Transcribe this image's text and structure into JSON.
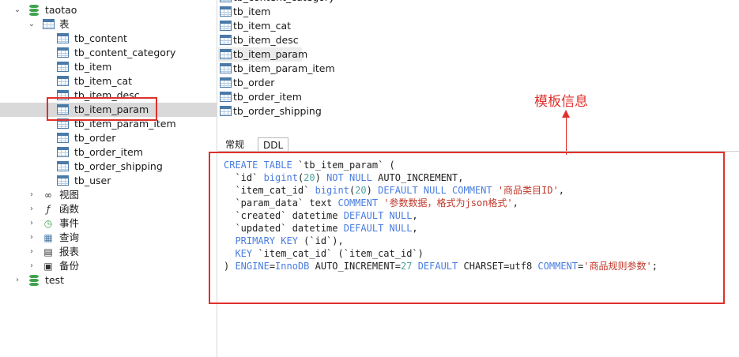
{
  "tree": {
    "db_taotao": "taotao",
    "tables_folder": "表",
    "tables": [
      "tb_content",
      "tb_content_category",
      "tb_item",
      "tb_item_cat",
      "tb_item_desc",
      "tb_item_param",
      "tb_item_param_item",
      "tb_order",
      "tb_order_item",
      "tb_order_shipping",
      "tb_user"
    ],
    "selected_table": "tb_item_param",
    "folders": [
      {
        "label": "视图",
        "icon": "eyeglasses-icon"
      },
      {
        "label": "函数",
        "icon": "function-icon"
      },
      {
        "label": "事件",
        "icon": "event-clock-icon"
      },
      {
        "label": "查询",
        "icon": "query-icon"
      },
      {
        "label": "报表",
        "icon": "report-icon"
      },
      {
        "label": "备份",
        "icon": "backup-icon"
      }
    ],
    "db_test": "test"
  },
  "table_list": {
    "cut_top": "tb_content_category",
    "items": [
      "tb_item",
      "tb_item_cat",
      "tb_item_desc",
      "tb_item_param",
      "tb_item_param_item",
      "tb_order",
      "tb_order_item",
      "tb_order_shipping"
    ],
    "hovered": "tb_item_param"
  },
  "annotation": "模板信息",
  "tabs": [
    "常规",
    "DDL"
  ],
  "active_tab": "DDL",
  "ddl": {
    "l1_kw": "CREATE TABLE",
    "l1_rest": " `tb_item_param` (",
    "l2_a": "  `id` ",
    "l2_kw1": "bigint",
    "l2_b": "(",
    "l2_num": "20",
    "l2_c": ") ",
    "l2_kw2": "NOT NULL",
    "l2_d": " AUTO_INCREMENT,",
    "l3_a": "  `item_cat_id` ",
    "l3_kw1": "bigint",
    "l3_b": "(",
    "l3_num": "20",
    "l3_c": ") ",
    "l3_kw2": "DEFAULT NULL COMMENT",
    "l3_d": " ",
    "l3_str": "'商品类目ID'",
    "l3_e": ",",
    "l4_a": "  `param_data` text ",
    "l4_kw": "COMMENT",
    "l4_b": " ",
    "l4_str": "'参数数据，格式为json格式'",
    "l4_c": ",",
    "l5_a": "  `created` datetime ",
    "l5_kw": "DEFAULT NULL",
    "l5_b": ",",
    "l6_a": "  `updated` datetime ",
    "l6_kw": "DEFAULT NULL",
    "l6_b": ",",
    "l7_a": "  ",
    "l7_kw": "PRIMARY KEY",
    "l7_b": " (`id`),",
    "l8_a": "  ",
    "l8_kw": "KEY",
    "l8_b": " `item_cat_id` (`item_cat_id`)",
    "l9_a": ") ",
    "l9_kw1": "ENGINE",
    "l9_b": "=",
    "l9_kw2": "InnoDB",
    "l9_c": " AUTO_INCREMENT=",
    "l9_num": "27",
    "l9_d": " ",
    "l9_kw3": "DEFAULT",
    "l9_e": " CHARSET=utf8 ",
    "l9_kw4": "COMMENT",
    "l9_f": "=",
    "l9_str": "'商品规则参数'",
    "l9_g": ";"
  },
  "colors": {
    "highlight_red": "#e0302c",
    "keyword_blue": "#4a7de0",
    "string_red": "#c0392b",
    "number_teal": "#4fa3a0",
    "db_green": "#3fa34d"
  }
}
